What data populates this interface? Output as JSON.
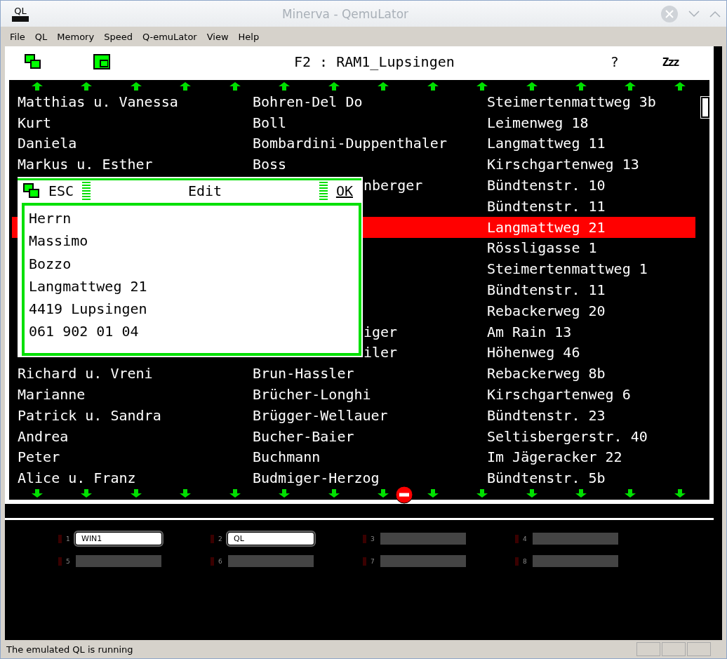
{
  "window": {
    "title": "Minerva - QemuLator",
    "app_icon": "QL"
  },
  "menu": [
    "File",
    "QL",
    "Memory",
    "Speed",
    "Q-emuLator",
    "View",
    "Help"
  ],
  "header": {
    "title": "F2 : RAM1_Lupsingen",
    "help": "?",
    "sleep": "Zzz"
  },
  "rows": [
    {
      "selected": false,
      "cells": [
        {
          "text": "Matthias u. Vanessa"
        },
        {
          "text": "Bohren-Del Do"
        },
        {
          "text": "Steimertenmattweg 3b"
        }
      ]
    },
    {
      "selected": false,
      "cells": [
        {
          "text": "Kurt"
        },
        {
          "text": "Boll"
        },
        {
          "text": "Leimenweg 18"
        }
      ]
    },
    {
      "selected": false,
      "cells": [
        {
          "text": "Daniela"
        },
        {
          "text": "Bombardini-Duppenthaler"
        },
        {
          "text": "Langmattweg 11"
        }
      ]
    },
    {
      "selected": false,
      "cells": [
        {
          "text": "Markus u. Esther"
        },
        {
          "text": "Boss"
        },
        {
          "text": "Kirschgartenweg 13"
        }
      ]
    },
    {
      "selected": false,
      "cells": [
        {},
        {
          "text": "nberger",
          "cut": true
        },
        {
          "text": "Bündtenstr. 10"
        }
      ]
    },
    {
      "selected": false,
      "cells": [
        {},
        {},
        {
          "text": "Bündtenstr. 11"
        }
      ]
    },
    {
      "selected": true,
      "cells": [
        {},
        {},
        {
          "text": "Langmattweg 21"
        }
      ]
    },
    {
      "selected": false,
      "cells": [
        {},
        {},
        {
          "text": "Rössligasse 1"
        }
      ]
    },
    {
      "selected": false,
      "cells": [
        {},
        {},
        {
          "text": "Steimertenmattweg 1"
        }
      ]
    },
    {
      "selected": false,
      "cells": [
        {},
        {},
        {
          "text": "Bündtenstr. 11"
        }
      ]
    },
    {
      "selected": false,
      "cells": [
        {},
        {},
        {
          "text": "Rebackerweg 20"
        }
      ]
    },
    {
      "selected": false,
      "cells": [
        {},
        {
          "text": "iger",
          "cut": true
        },
        {
          "text": "Am Rain 13"
        }
      ]
    },
    {
      "selected": false,
      "cells": [
        {},
        {
          "text": "iler",
          "cut": true
        },
        {
          "text": "Höhenweg 46"
        }
      ]
    },
    {
      "selected": false,
      "cells": [
        {
          "text": "Richard u. Vreni"
        },
        {
          "text": "Brun-Hassler"
        },
        {
          "text": "Rebackerweg 8b"
        }
      ]
    },
    {
      "selected": false,
      "cells": [
        {
          "text": "Marianne"
        },
        {
          "text": "Brücher-Longhi"
        },
        {
          "text": "Kirschgartenweg 6"
        }
      ]
    },
    {
      "selected": false,
      "cells": [
        {
          "text": "Patrick u. Sandra"
        },
        {
          "text": "Brügger-Wellauer"
        },
        {
          "text": "Bündtenstr. 23"
        }
      ]
    },
    {
      "selected": false,
      "cells": [
        {
          "text": "Andrea"
        },
        {
          "text": "Bucher-Baier"
        },
        {
          "text": "Seltisbergerstr. 40"
        }
      ]
    },
    {
      "selected": false,
      "cells": [
        {
          "text": "Peter"
        },
        {
          "text": "Buchmann"
        },
        {
          "text": "Im Jägeracker 22"
        }
      ]
    },
    {
      "selected": false,
      "cells": [
        {
          "text": "Alice u. Franz"
        },
        {
          "text": "Budmiger-Herzog"
        },
        {
          "text": "Bündtenstr. 5b"
        }
      ]
    }
  ],
  "dialog": {
    "esc": "ESC",
    "title": "Edit",
    "ok": "OK",
    "lines": [
      "Herrn",
      "Massimo",
      "Bozzo",
      "Langmattweg 21",
      "4419 Lupsingen",
      "061 902 01 04"
    ]
  },
  "slots": [
    {
      "number": "1",
      "label": "WIN1",
      "active": true
    },
    {
      "number": "2",
      "label": "QL",
      "active": true
    },
    {
      "number": "3",
      "active": false
    },
    {
      "number": "4",
      "active": false
    },
    {
      "number": "5",
      "active": false
    },
    {
      "number": "6",
      "active": false
    },
    {
      "number": "7",
      "active": false
    },
    {
      "number": "8",
      "active": false
    }
  ],
  "status_bar": "The emulated QL is running"
}
